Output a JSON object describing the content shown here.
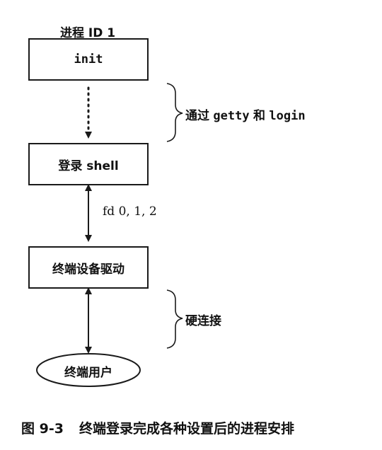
{
  "process_id_label": "进程 ID 1",
  "nodes": {
    "init": "init",
    "login_shell": "登录 shell",
    "terminal_driver": "终端设备驱动",
    "terminal_user": "终端用户"
  },
  "edge_labels": {
    "getty_login_prefix": "通过",
    "getty_cmd": "getty",
    "and": "和",
    "login_cmd": "login",
    "fds": "fd 0, 1, 2",
    "hardwired": "硬连接"
  },
  "caption": {
    "number": "图 9-3",
    "text": "终端登录完成各种设置后的进程安排"
  }
}
